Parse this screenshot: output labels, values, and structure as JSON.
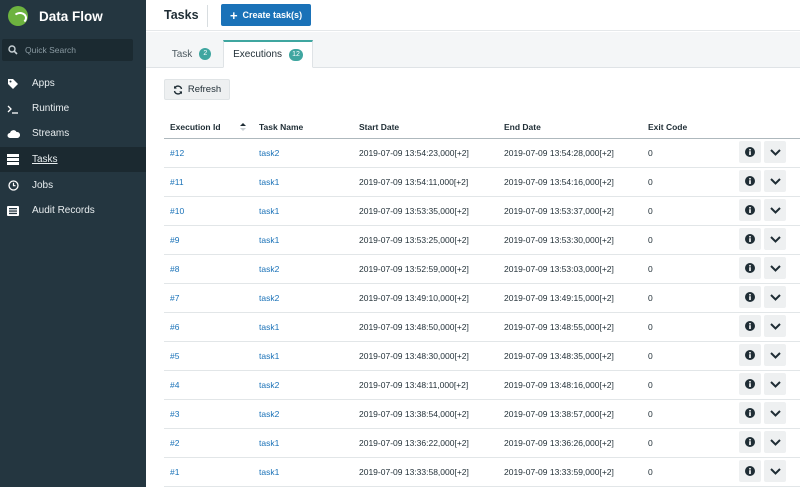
{
  "app": {
    "name": "Data Flow"
  },
  "sidebar": {
    "search_placeholder": "Quick Search",
    "items": [
      {
        "label": "Apps",
        "icon": "tags-icon"
      },
      {
        "label": "Runtime",
        "icon": "terminal-icon"
      },
      {
        "label": "Streams",
        "icon": "cloud-icon"
      },
      {
        "label": "Tasks",
        "icon": "server-icon",
        "active": true
      },
      {
        "label": "Jobs",
        "icon": "clock-icon"
      },
      {
        "label": "Audit Records",
        "icon": "list-icon"
      }
    ]
  },
  "header": {
    "title": "Tasks",
    "create_label": "Create task(s)"
  },
  "tabs": [
    {
      "label": "Task",
      "count": "2"
    },
    {
      "label": "Executions",
      "count": "12",
      "active": true
    }
  ],
  "toolbar": {
    "refresh_label": "Refresh"
  },
  "table": {
    "columns": [
      "Execution Id",
      "Task Name",
      "Start Date",
      "End Date",
      "Exit Code"
    ],
    "rows": [
      {
        "id": "#12",
        "task": "task2",
        "start": "2019-07-09 13:54:23,000[+2]",
        "end": "2019-07-09 13:54:28,000[+2]",
        "exit": "0"
      },
      {
        "id": "#11",
        "task": "task1",
        "start": "2019-07-09 13:54:11,000[+2]",
        "end": "2019-07-09 13:54:16,000[+2]",
        "exit": "0"
      },
      {
        "id": "#10",
        "task": "task1",
        "start": "2019-07-09 13:53:35,000[+2]",
        "end": "2019-07-09 13:53:37,000[+2]",
        "exit": "0"
      },
      {
        "id": "#9",
        "task": "task1",
        "start": "2019-07-09 13:53:25,000[+2]",
        "end": "2019-07-09 13:53:30,000[+2]",
        "exit": "0"
      },
      {
        "id": "#8",
        "task": "task2",
        "start": "2019-07-09 13:52:59,000[+2]",
        "end": "2019-07-09 13:53:03,000[+2]",
        "exit": "0"
      },
      {
        "id": "#7",
        "task": "task2",
        "start": "2019-07-09 13:49:10,000[+2]",
        "end": "2019-07-09 13:49:15,000[+2]",
        "exit": "0"
      },
      {
        "id": "#6",
        "task": "task1",
        "start": "2019-07-09 13:48:50,000[+2]",
        "end": "2019-07-09 13:48:55,000[+2]",
        "exit": "0"
      },
      {
        "id": "#5",
        "task": "task1",
        "start": "2019-07-09 13:48:30,000[+2]",
        "end": "2019-07-09 13:48:35,000[+2]",
        "exit": "0"
      },
      {
        "id": "#4",
        "task": "task2",
        "start": "2019-07-09 13:48:11,000[+2]",
        "end": "2019-07-09 13:48:16,000[+2]",
        "exit": "0"
      },
      {
        "id": "#3",
        "task": "task2",
        "start": "2019-07-09 13:38:54,000[+2]",
        "end": "2019-07-09 13:38:57,000[+2]",
        "exit": "0"
      },
      {
        "id": "#2",
        "task": "task1",
        "start": "2019-07-09 13:36:22,000[+2]",
        "end": "2019-07-09 13:36:26,000[+2]",
        "exit": "0"
      },
      {
        "id": "#1",
        "task": "task1",
        "start": "2019-07-09 13:33:58,000[+2]",
        "end": "2019-07-09 13:33:59,000[+2]",
        "exit": "0"
      }
    ]
  },
  "colors": {
    "sidebar_bg": "#243640",
    "primary": "#1a72b8",
    "accent": "#3fa6a0",
    "brand": "#6db33f"
  }
}
